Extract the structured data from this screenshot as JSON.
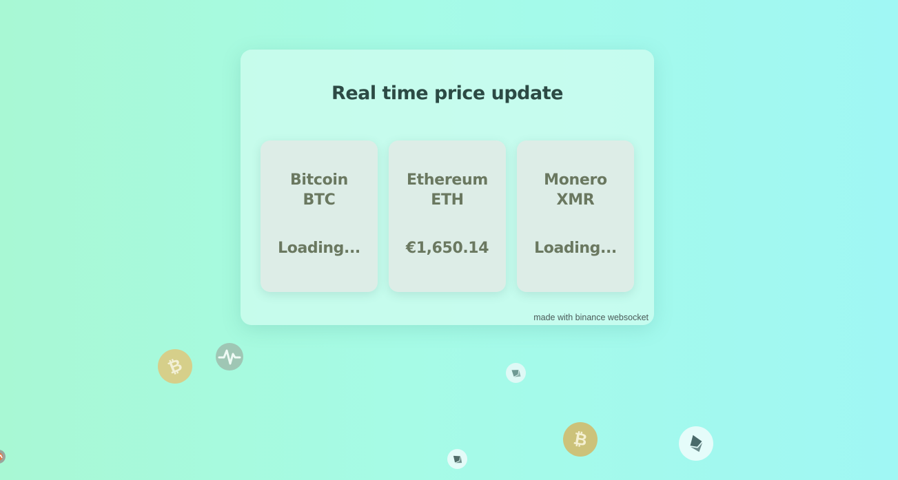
{
  "panel": {
    "title": "Real time price update",
    "footer": "made with binance websocket"
  },
  "coins": [
    {
      "name": "Bitcoin",
      "symbol": "BTC",
      "price": "Loading..."
    },
    {
      "name": "Ethereum",
      "symbol": "ETH",
      "price": "€1,650.14"
    },
    {
      "name": "Monero",
      "symbol": "XMR",
      "price": "Loading..."
    }
  ],
  "floating_icons": [
    {
      "icon": "bitcoin-icon",
      "color": "#d6cf8a"
    },
    {
      "icon": "pulse-icon",
      "color": "#9fc6b4"
    },
    {
      "icon": "ethereum-icon",
      "color": "#dff9f6"
    },
    {
      "icon": "bitcoin-icon",
      "color": "#ccc27a"
    },
    {
      "icon": "ethereum-icon",
      "color": "#e3fbf8"
    },
    {
      "icon": "ethereum-icon",
      "color": "#e5fcfa"
    },
    {
      "icon": "monero-icon",
      "color": "#9aa49c"
    }
  ],
  "colors": {
    "title": "#2c4a44",
    "card_text": "#6a7860",
    "background_left": "#a8f8d4",
    "background_right": "#a0f7f4"
  }
}
